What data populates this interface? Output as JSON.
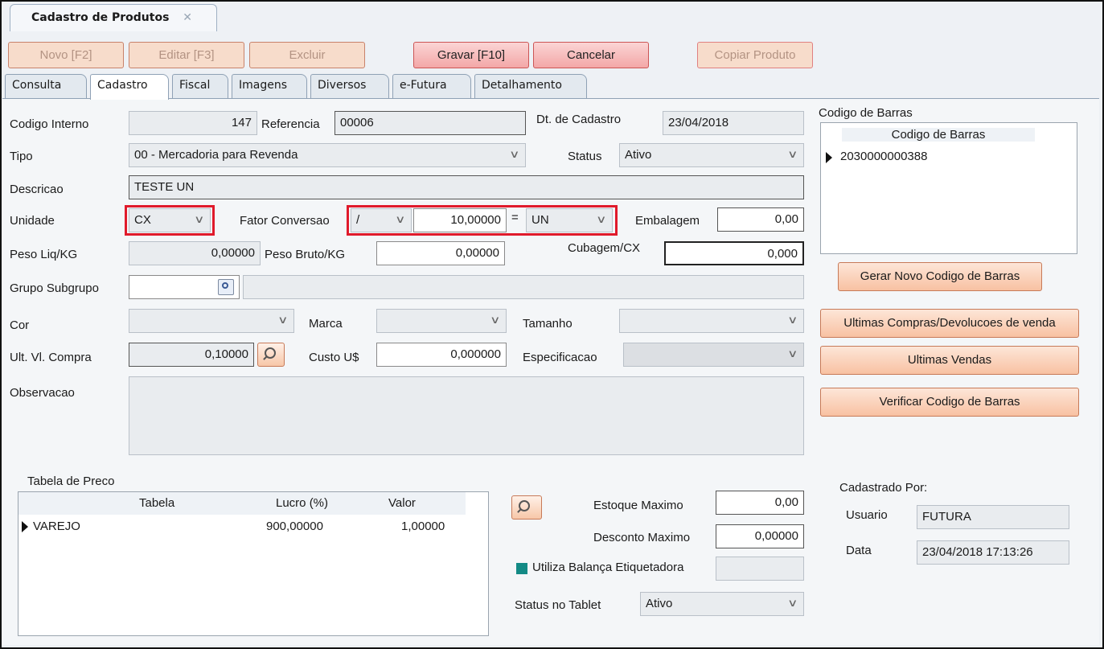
{
  "doc_tab": {
    "title": "Cadastro de Produtos",
    "close": "✕"
  },
  "toolbar": {
    "novo": "Novo [F2]",
    "editar": "Editar [F3]",
    "excluir": "Excluir",
    "gravar": "Gravar [F10]",
    "cancelar": "Cancelar",
    "copiar": "Copiar Produto"
  },
  "tabs": [
    "Consulta",
    "Cadastro",
    "Fiscal",
    "Imagens",
    "Diversos",
    "e-Futura",
    "Detalhamento"
  ],
  "form": {
    "codigo_interno_label": "Codigo Interno",
    "codigo_interno": "147",
    "referencia_label": "Referencia",
    "referencia": "00006",
    "dt_cadastro_label": "Dt. de Cadastro",
    "dt_cadastro": "23/04/2018",
    "tipo_label": "Tipo",
    "tipo": "00 - Mercadoria para Revenda",
    "status_label": "Status",
    "status": "Ativo",
    "descricao_label": "Descricao",
    "descricao": "TESTE UN",
    "unidade_label": "Unidade",
    "unidade": "CX",
    "fator_label": "Fator Conversao",
    "fator_op": "/",
    "fator_valor": "10,00000",
    "equals": "=",
    "fator_unidade": "UN",
    "embalagem_label": "Embalagem",
    "embalagem": "0,00",
    "peso_liq_label": "Peso Liq/KG",
    "peso_liq": "0,00000",
    "peso_bruto_label": "Peso Bruto/KG",
    "peso_bruto": "0,00000",
    "cubagem_label": "Cubagem/CX",
    "cubagem": "0,000",
    "grupo_label": "Grupo Subgrupo",
    "cor_label": "Cor",
    "marca_label": "Marca",
    "tamanho_label": "Tamanho",
    "ult_compra_label": "Ult. Vl. Compra",
    "ult_compra": "0,10000",
    "custo_label": "Custo U$",
    "custo": "0,000000",
    "especificacao_label": "Especificacao",
    "observacao_label": "Observacao"
  },
  "barcode": {
    "group_label": "Codigo de Barras",
    "column": "Codigo de Barras",
    "rows": [
      "2030000000388"
    ]
  },
  "side_buttons": {
    "gerar": "Gerar Novo Codigo de Barras",
    "ultimas_compras": "Ultimas Compras/Devolucoes de venda",
    "ultimas_vendas": "Ultimas Vendas",
    "verificar": "Verificar Codigo de Barras"
  },
  "preco": {
    "group_label": "Tabela de Preco",
    "columns": [
      "Tabela",
      "Lucro (%)",
      "Valor"
    ],
    "rows": [
      {
        "tabela": "VAREJO",
        "lucro": "900,00000",
        "valor": "1,00000"
      }
    ]
  },
  "estoque": {
    "max_label": "Estoque Maximo",
    "max": "0,00",
    "desc_label": "Desconto Maximo",
    "desc": "0,00000",
    "balanca_label": "Utiliza Balança Etiquetadora",
    "tablet_label": "Status no Tablet",
    "tablet": "Ativo"
  },
  "cadastrado": {
    "group_label": "Cadastrado Por:",
    "usuario_label": "Usuario",
    "usuario": "FUTURA",
    "data_label": "Data",
    "data": "23/04/2018 17:13:26"
  },
  "colors": {
    "accent_red": "#e01a2b",
    "orange_button": "#f8c1a2",
    "teal_checkbox": "#138a85"
  }
}
